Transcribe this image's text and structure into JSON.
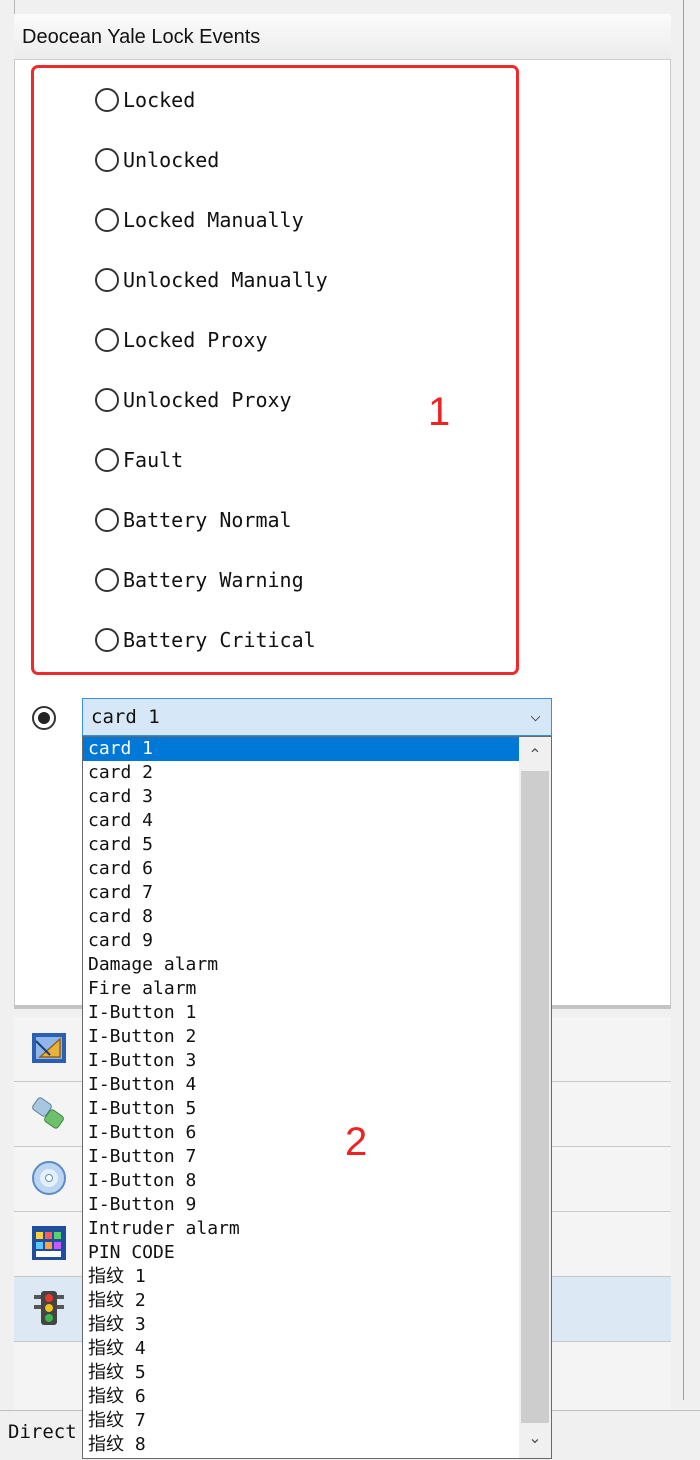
{
  "header": {
    "title": "Deocean Yale Lock Events"
  },
  "events": [
    "Locked",
    "Unlocked",
    "Locked Manually",
    "Unlocked Manually",
    "Locked Proxy",
    "Unlocked Proxy",
    "Fault",
    "Battery Normal",
    "Battery Warning",
    "Battery Critical"
  ],
  "annotations": {
    "box1": "1",
    "box2": "2"
  },
  "combo": {
    "selected": "card 1",
    "chevron": "⌵"
  },
  "dropdown": {
    "options": [
      "card 1",
      "card 2",
      "card 3",
      "card 4",
      "card 5",
      "card 6",
      "card 7",
      "card 8",
      "card 9",
      "Damage alarm",
      "Fire alarm",
      "I-Button 1",
      "I-Button 2",
      "I-Button 3",
      "I-Button 4",
      "I-Button 5",
      "I-Button 6",
      "I-Button 7",
      "I-Button 8",
      "I-Button 9",
      "Intruder alarm",
      "PIN CODE",
      "指纹 1",
      "指纹 2",
      "指纹 3",
      "指纹 4",
      "指纹 5",
      "指纹 6",
      "指纹 7",
      "指纹 8"
    ],
    "selected_index": 0,
    "scroll_up": "⌃",
    "scroll_down": "⌄"
  },
  "status_bar": {
    "text": "Direct"
  },
  "side_icons": [
    "design-tool-icon",
    "plug-icon",
    "disc-icon",
    "color-palette-icon",
    "traffic-light-icon"
  ]
}
